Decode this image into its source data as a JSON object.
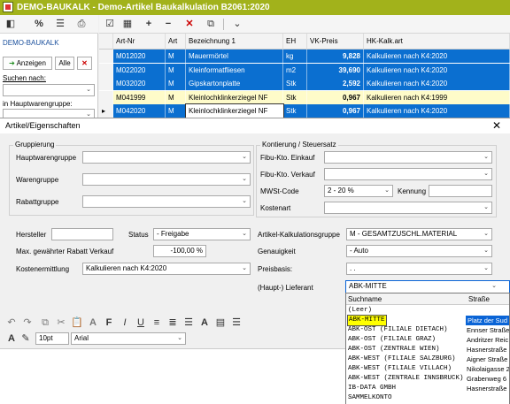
{
  "window": {
    "title": "DEMO-BAUKALK - Demo-Artikel Baukalkulation B2061:2020"
  },
  "left_panel": {
    "title": "DEMO-BAUKALK",
    "anzeigen_label": "Anzeigen",
    "alle_label": "Alle",
    "suchen_label": "Suchen nach:",
    "hwg_label": "in Hauptwarengruppe:"
  },
  "grid": {
    "columns": [
      "Art-Nr",
      "Art",
      "Bezeichnung 1",
      "EH",
      "VK-Preis",
      "HK-Kalk.art"
    ],
    "rows": [
      {
        "art_nr": "M012020",
        "art": "M",
        "bez": "Mauermörtel",
        "eh": "kg",
        "vk": "9,828",
        "hk": "Kalkulieren nach K4:2020",
        "style": "blue"
      },
      {
        "art_nr": "M022020",
        "art": "M",
        "bez": "Kleinformatfliesen",
        "eh": "m2",
        "vk": "39,690",
        "hk": "Kalkulieren nach K4:2020",
        "style": "blue"
      },
      {
        "art_nr": "M032020",
        "art": "M",
        "bez": "Gipskartonplatte",
        "eh": "Stk",
        "vk": "2,592",
        "hk": "Kalkulieren nach K4:2020",
        "style": "blue"
      },
      {
        "art_nr": "M041999",
        "art": "M",
        "bez": "Kleinlochklinkerziegel NF",
        "eh": "Stk",
        "vk": "0,967",
        "hk": "Kalkulieren nach K4:1999",
        "style": "yellow"
      },
      {
        "art_nr": "M042020",
        "art": "M",
        "bez": "Kleinlochklinkerziegel NF",
        "eh": "Stk",
        "vk": "0,967",
        "hk": "Kalkulieren nach K4:2020",
        "style": "blue"
      },
      {
        "art_nr": "",
        "art": "",
        "bez": "",
        "eh": "",
        "vk": "",
        "hk": "",
        "style": "yellow"
      }
    ]
  },
  "dialog": {
    "title": "Artikel/Eigenschaften",
    "gruppierung": {
      "label": "Gruppierung",
      "hauptwarengruppe": "Hauptwarengruppe",
      "warengruppe": "Warengruppe",
      "rabattgruppe": "Rabattgruppe"
    },
    "kontierung": {
      "label": "Kontierung / Steuersatz",
      "fibu_einkauf": "Fibu-Kto. Einkauf",
      "fibu_verkauf": "Fibu-Kto. Verkauf",
      "mwst_label": "MWSt-Code",
      "mwst_value": "2 - 20 %",
      "kennung_label": "Kennung",
      "kostenart": "Kostenart"
    },
    "hersteller_label": "Hersteller",
    "status_label": "Status",
    "status_value": "- Freigabe",
    "max_rabatt_label": "Max. gewährter Rabatt Verkauf",
    "max_rabatt_value": "-100,00 %",
    "kostenermittlung_label": "Kostenermittlung",
    "kostenermittlung_value": "Kalkulieren nach K4:2020",
    "akg_label": "Artikel-Kalkulationsgruppe",
    "akg_value": "M - GESAMTZUSCHL.MATERIAL",
    "genauigkeit_label": "Genauigkeit",
    "genauigkeit_value": "- Auto",
    "preisbasis_label": "Preisbasis:",
    "preisbasis_value": ". .",
    "lieferant_label": "(Haupt-) Lieferant",
    "lieferant_value": "ABK-MITTE"
  },
  "editor": {
    "font_size": "10pt",
    "font_name": "Arial"
  },
  "dropdown": {
    "columns": [
      "Suchname",
      "Straße"
    ],
    "rows": [
      {
        "name": "(Leer)",
        "street": ""
      },
      {
        "name": "ABK-MITTE",
        "street": "Platz der Sud",
        "selected": true
      },
      {
        "name": "ABK-OST (FILIALE DIETACH)",
        "street": "Ennser Straße"
      },
      {
        "name": "ABK-OST (FILIALE GRAZ)",
        "street": "Andritzer Reic"
      },
      {
        "name": "ABK-OST (ZENTRALE WIEN)",
        "street": "Hasnerstraße"
      },
      {
        "name": "ABK-WEST (FILIALE SALZBURG)",
        "street": "Aigner Straße"
      },
      {
        "name": "ABK-WEST (FILIALE VILLACH)",
        "street": "Nikolaigasse 2"
      },
      {
        "name": "ABK-WEST (ZENTRALE INNSBRUCK)",
        "street": "Grabenweg 6"
      },
      {
        "name": "IB-DATA GMBH",
        "street": "Hasnerstraße"
      },
      {
        "name": "SAMMELKONTO",
        "street": ""
      }
    ]
  },
  "colors": {
    "titlebar": "#a2b21b",
    "row_blue": "#0b6fd0",
    "row_yellow": "#fefbc9",
    "highlight": "#ffff00"
  }
}
